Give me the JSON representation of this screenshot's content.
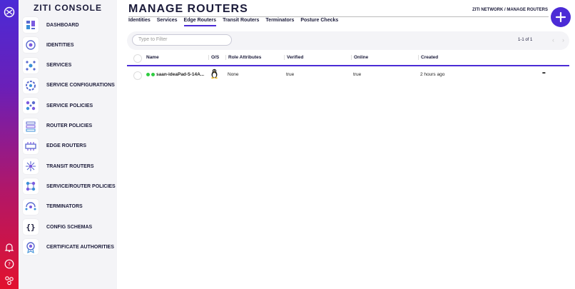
{
  "app": {
    "title": "ZITI CONSOLE"
  },
  "colors": {
    "accent": "#4b2bd6",
    "online": "#2ecc40",
    "rail_top": "#4b2bd6",
    "rail_bottom": "#e2122e"
  },
  "nav": {
    "items": [
      {
        "label": "DASHBOARD",
        "icon": "dashboard-icon"
      },
      {
        "label": "IDENTITIES",
        "icon": "identities-icon"
      },
      {
        "label": "SERVICES",
        "icon": "services-icon"
      },
      {
        "label": "SERVICE CONFIGURATIONS",
        "icon": "service-configurations-icon"
      },
      {
        "label": "SERVICE POLICIES",
        "icon": "service-policies-icon"
      },
      {
        "label": "ROUTER POLICIES",
        "icon": "router-policies-icon"
      },
      {
        "label": "EDGE ROUTERS",
        "icon": "edge-routers-icon"
      },
      {
        "label": "TRANSIT ROUTERS",
        "icon": "transit-routers-icon"
      },
      {
        "label": "SERVICE/ROUTER POLICIES",
        "icon": "service-router-policies-icon"
      },
      {
        "label": "TERMINATORS",
        "icon": "terminators-icon"
      },
      {
        "label": "CONFIG SCHEMAS",
        "icon": "config-schemas-icon"
      },
      {
        "label": "CERTIFICATE AUTHORITIES",
        "icon": "certificate-authorities-icon"
      }
    ]
  },
  "rail": {
    "icons": [
      "ziti-logo-icon",
      "bell-icon",
      "help-icon",
      "network-icon"
    ]
  },
  "header": {
    "title": "MANAGE ROUTERS",
    "breadcrumb": "ZITI NETWORK / MANAGE ROUTERS",
    "add_icon": "plus-icon"
  },
  "tabs": [
    {
      "label": "Identities",
      "active": false
    },
    {
      "label": "Services",
      "active": false
    },
    {
      "label": "Edge Routers",
      "active": true
    },
    {
      "label": "Transit Routers",
      "active": false
    },
    {
      "label": "Terminators",
      "active": false
    },
    {
      "label": "Posture Checks",
      "active": false
    }
  ],
  "toolbar": {
    "filter_placeholder": "Type to Filter",
    "count": "1-1 of 1",
    "prev": "‹",
    "next": "›"
  },
  "table": {
    "columns": [
      "Name",
      "O/S",
      "Role Attributes",
      "Verified",
      "Online",
      "Created"
    ],
    "rows": [
      {
        "name": "saan-ideaPad-5-14A...",
        "os_icon": "linux-penguin-icon",
        "role_attributes": "None",
        "verified": "true",
        "online": "true",
        "created": "2 hours ago",
        "menu": "•••"
      }
    ]
  }
}
